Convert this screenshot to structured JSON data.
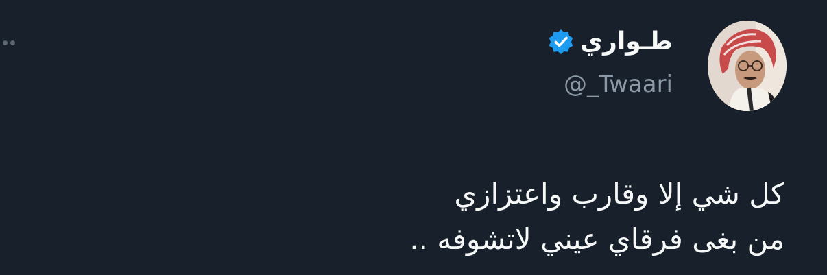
{
  "tweet": {
    "author": {
      "display_name": "طـواري",
      "handle": "@_Twaari",
      "verified": true,
      "avatar": "profile-photo"
    },
    "body_lines": [
      "كل شي إلا وقارب واعتزازي",
      "من بغى فرقاي عيني لاتشوفه .."
    ],
    "more_icon": "more-dots-icon"
  },
  "colors": {
    "background": "#17202b",
    "text": "#f7f9f9",
    "secondary_text": "#8b98a5",
    "verified": "#1d9bf0"
  }
}
